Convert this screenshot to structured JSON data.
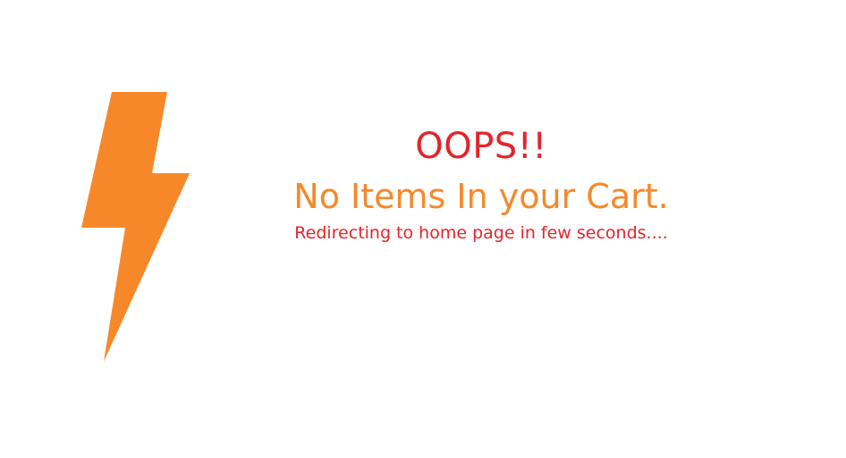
{
  "icon": {
    "name": "lightning-bolt-icon",
    "color": "#f6882a"
  },
  "message": {
    "title": "OOPS!!",
    "title_color": "#e3242b",
    "subtitle": "No Items In your Cart.",
    "subtitle_color": "#f6882a",
    "note": "Redirecting to home page in few seconds....",
    "note_color": "#e3242b"
  }
}
